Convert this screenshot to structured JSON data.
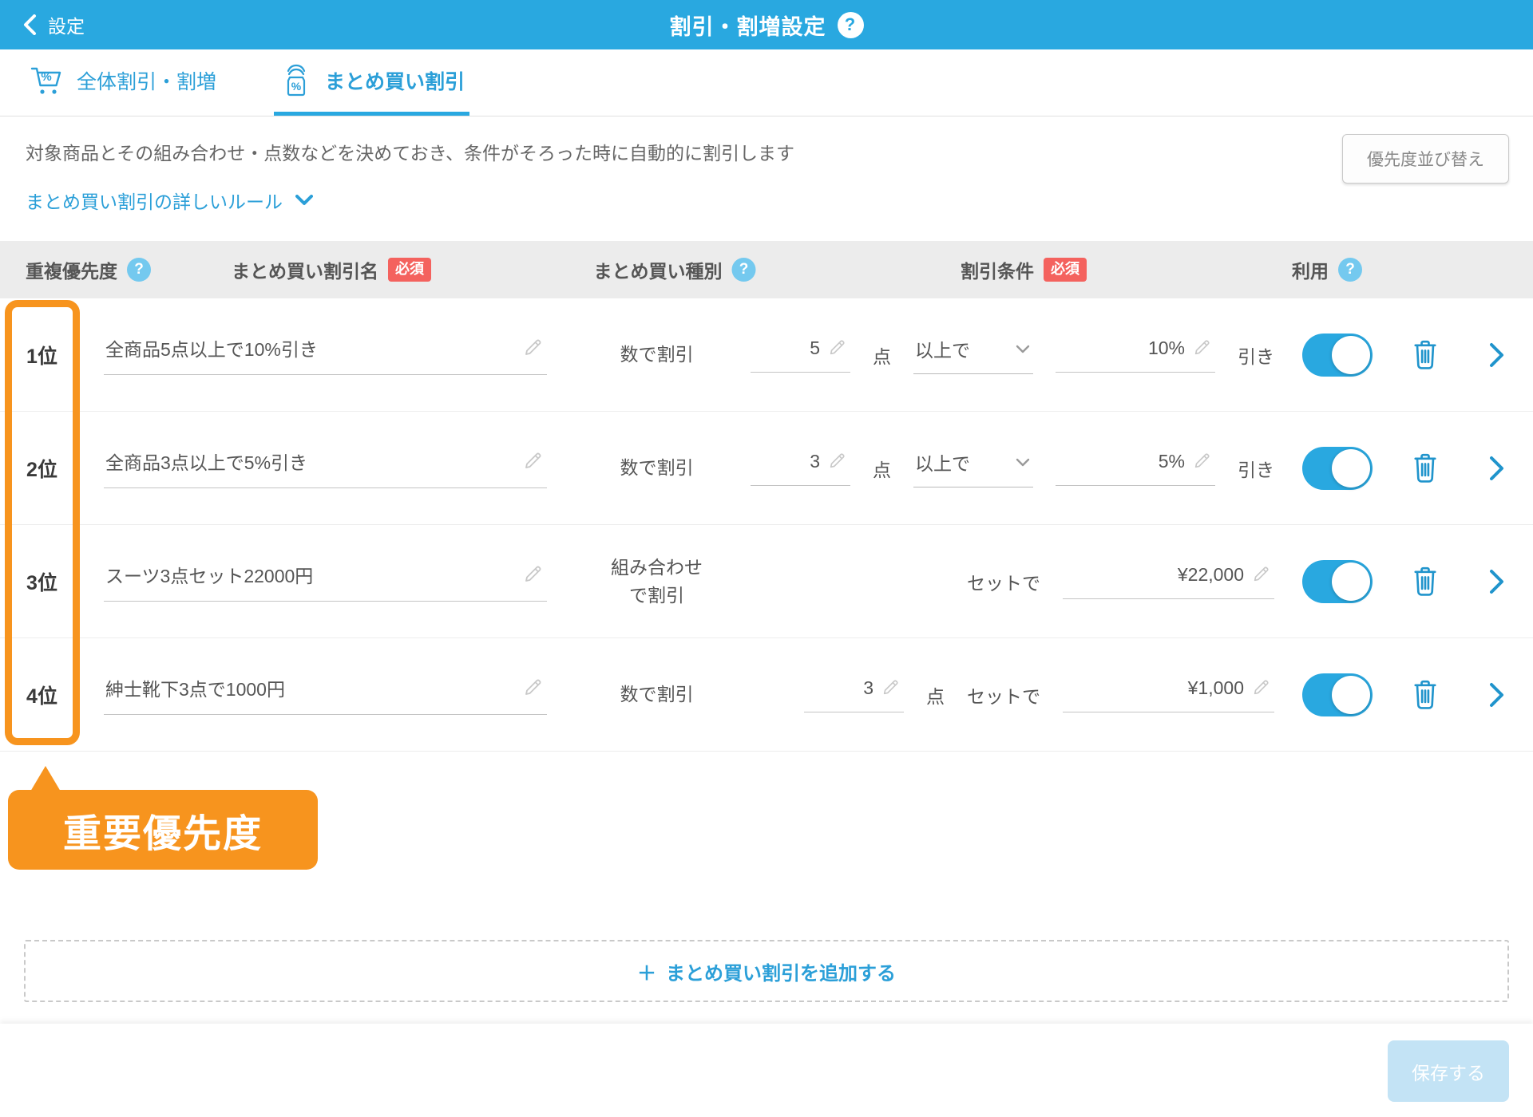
{
  "colors": {
    "accent_blue": "#29a8e0",
    "link_blue": "#2b9fd8",
    "badge_red": "#f4625e",
    "annotation_orange": "#f7941e",
    "disabled_save_blue": "#c3e3f5"
  },
  "header": {
    "back_label": "設定",
    "title": "割引・割増設定",
    "help": "?"
  },
  "tabs": [
    {
      "label": "全体割引・割増",
      "icon": "cart-percent-icon",
      "active": false
    },
    {
      "label": "まとめ買い割引",
      "icon": "bundle-percent-icon",
      "active": true
    }
  ],
  "intro": {
    "description": "対象商品とその組み合わせ・点数などを決めておき、条件がそろった時に自動的に割引します",
    "rules_link": "まとめ買い割引の詳しいルール",
    "sort_button": "優先度並び替え"
  },
  "table": {
    "headers": {
      "priority": "重複優先度",
      "name": "まとめ買い割引名",
      "type": "まとめ買い種別",
      "condition": "割引条件",
      "use": "利用"
    },
    "required_badge": "必須",
    "help": "?"
  },
  "rows": [
    {
      "rank": "1位",
      "name": "全商品5点以上で10%引き",
      "type_lines": [
        "数で割引"
      ],
      "qty": "5",
      "qty_unit": "点",
      "threshold": "以上で",
      "amount": "10%",
      "amount_suffix": "引き",
      "enabled": true
    },
    {
      "rank": "2位",
      "name": "全商品3点以上で5%引き",
      "type_lines": [
        "数で割引"
      ],
      "qty": "3",
      "qty_unit": "点",
      "threshold": "以上で",
      "amount": "5%",
      "amount_suffix": "引き",
      "enabled": true
    },
    {
      "rank": "3位",
      "name": "スーツ3点セット22000円",
      "type_lines": [
        "組み合わせ",
        "で割引"
      ],
      "set_label": "セットで",
      "amount": "¥22,000",
      "enabled": true
    },
    {
      "rank": "4位",
      "name": "紳士靴下3点で1000円",
      "type_lines": [
        "数で割引"
      ],
      "qty": "3",
      "qty_unit": "点",
      "set_label": "セットで",
      "amount": "¥1,000",
      "enabled": true
    }
  ],
  "annotation": {
    "label": "重要優先度"
  },
  "add_button": {
    "plus": "＋",
    "label": "まとめ買い割引を追加する"
  },
  "footer": {
    "save_label": "保存する"
  }
}
